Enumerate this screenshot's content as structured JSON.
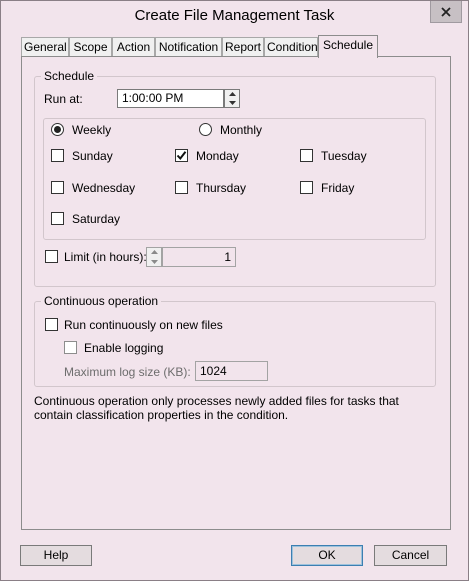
{
  "window": {
    "title": "Create File Management Task"
  },
  "tabs": [
    "General",
    "Scope",
    "Action",
    "Notification",
    "Report",
    "Condition",
    "Schedule"
  ],
  "active_tab": "Schedule",
  "schedule": {
    "legend": "Schedule",
    "run_at_label": "Run at:",
    "run_at_value": "1:00:00 PM",
    "frequency": {
      "weekly_label": "Weekly",
      "monthly_label": "Monthly",
      "selected": "Weekly"
    },
    "days": [
      {
        "label": "Sunday",
        "checked": false
      },
      {
        "label": "Monday",
        "checked": true
      },
      {
        "label": "Tuesday",
        "checked": false
      },
      {
        "label": "Wednesday",
        "checked": false
      },
      {
        "label": "Thursday",
        "checked": false
      },
      {
        "label": "Friday",
        "checked": false
      },
      {
        "label": "Saturday",
        "checked": false
      }
    ],
    "limit_label": "Limit (in hours):",
    "limit_checked": false,
    "limit_value": "1"
  },
  "continuous": {
    "legend": "Continuous operation",
    "run_label": "Run continuously on new files",
    "run_checked": false,
    "logging_label": "Enable logging",
    "logging_checked": false,
    "max_log_label": "Maximum log size (KB):",
    "max_log_value": "1024"
  },
  "description": "Continuous operation only processes newly added files for tasks that contain classification properties in the condition.",
  "buttons": {
    "help": "Help",
    "ok": "OK",
    "cancel": "Cancel"
  }
}
